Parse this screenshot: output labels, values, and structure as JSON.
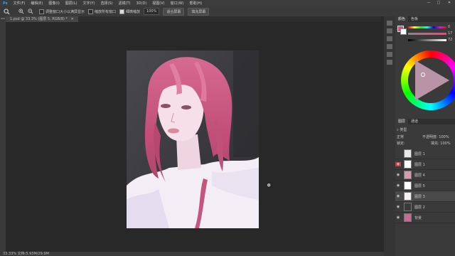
{
  "menu": [
    "文件(F)",
    "编辑(E)",
    "图像(I)",
    "图层(L)",
    "文字(Y)",
    "选择(S)",
    "滤镜(T)",
    "3D(D)",
    "视图(V)",
    "窗口(W)",
    "帮助(H)"
  ],
  "window_controls": [
    "—",
    "□",
    "✕"
  ],
  "options": {
    "tool_icon": "zoom-icon",
    "resize_label": "调整窗口大小以满屏显示",
    "zoom_all_label": "缩放所有窗口",
    "scrubby_label": "细微缩放",
    "zoom_value": "100%",
    "fit_screen": "适合屏幕",
    "fill_screen": "填充屏幕"
  },
  "doc_tab": "1.psd @ 33.3% (图层 5, RGB/8) *",
  "status": "33.33%   文档:5.93M/29.9M",
  "panel": {
    "color_tabs": [
      "颜色",
      "色板"
    ],
    "slider_values": [
      "0",
      "17",
      "72"
    ],
    "layer_tabs": [
      "图层",
      "通道"
    ],
    "filter_label": "类型",
    "blend_mode": "正常",
    "opacity": "不透明度: 100%",
    "lock_label": "锁定:",
    "fill": "填充: 100%",
    "layers": [
      {
        "name": "图层 1",
        "visible": false,
        "thumb": "#e8e8e8",
        "selected": false
      },
      {
        "name": "图层 1",
        "visible": true,
        "thumb": "#ffffff",
        "selected": false
      },
      {
        "name": "图层 4",
        "visible": true,
        "thumb": "#d89ab0",
        "selected": false
      },
      {
        "name": "图层 5",
        "visible": true,
        "thumb": "#ffffff",
        "selected": false
      },
      {
        "name": "图层 3",
        "visible": true,
        "thumb": "#f4f0f4",
        "selected": true
      },
      {
        "name": "图层 2",
        "visible": true,
        "thumb": "#3a3a3a",
        "selected": false
      },
      {
        "name": "背景",
        "visible": true,
        "thumb": "#c86a94",
        "selected": false
      }
    ]
  },
  "colors": {
    "hair": "#c9567e",
    "bg_dark": "#3d3d40",
    "skin": "#f3e6ee",
    "panel_red": "#c0404a"
  }
}
